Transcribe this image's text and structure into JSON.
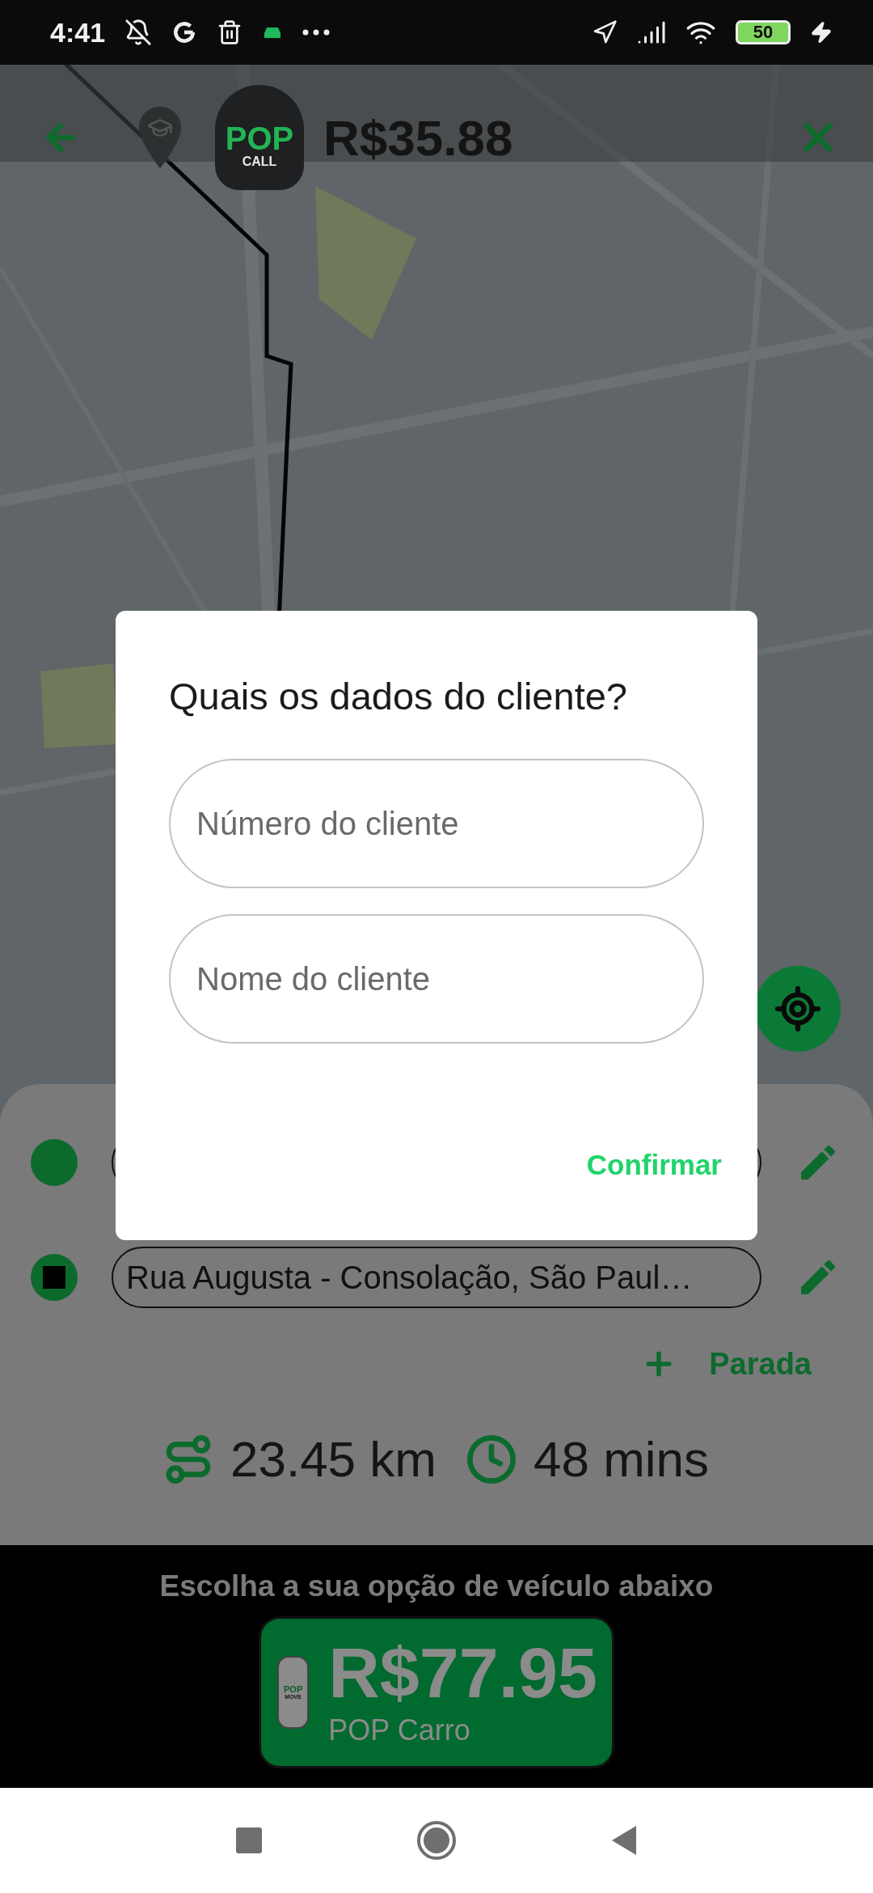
{
  "status_bar": {
    "time": "4:41",
    "battery": "50"
  },
  "header": {
    "logo_top": "POP",
    "logo_bottom": "CALL",
    "price": "R$35.88"
  },
  "route": {
    "stops": [
      {
        "kind": "origin"
      },
      {
        "kind": "destination",
        "address": "Rua Augusta - Consolação, São Paul…"
      }
    ],
    "add_stop": "Parada",
    "distance": "23.45 km",
    "duration": "48 mins"
  },
  "vehicles": {
    "prompt": "Escolha a sua opção de veículo abaixo",
    "options": [
      {
        "price": "R$77.95",
        "name": "POP Carro",
        "badge_top": "POP",
        "badge_bottom": "MOVE"
      }
    ]
  },
  "dialog": {
    "title": "Quais os dados do cliente?",
    "fields": [
      {
        "placeholder": "Número do cliente"
      },
      {
        "placeholder": "Nome do cliente"
      }
    ],
    "confirm": "Confirmar"
  }
}
